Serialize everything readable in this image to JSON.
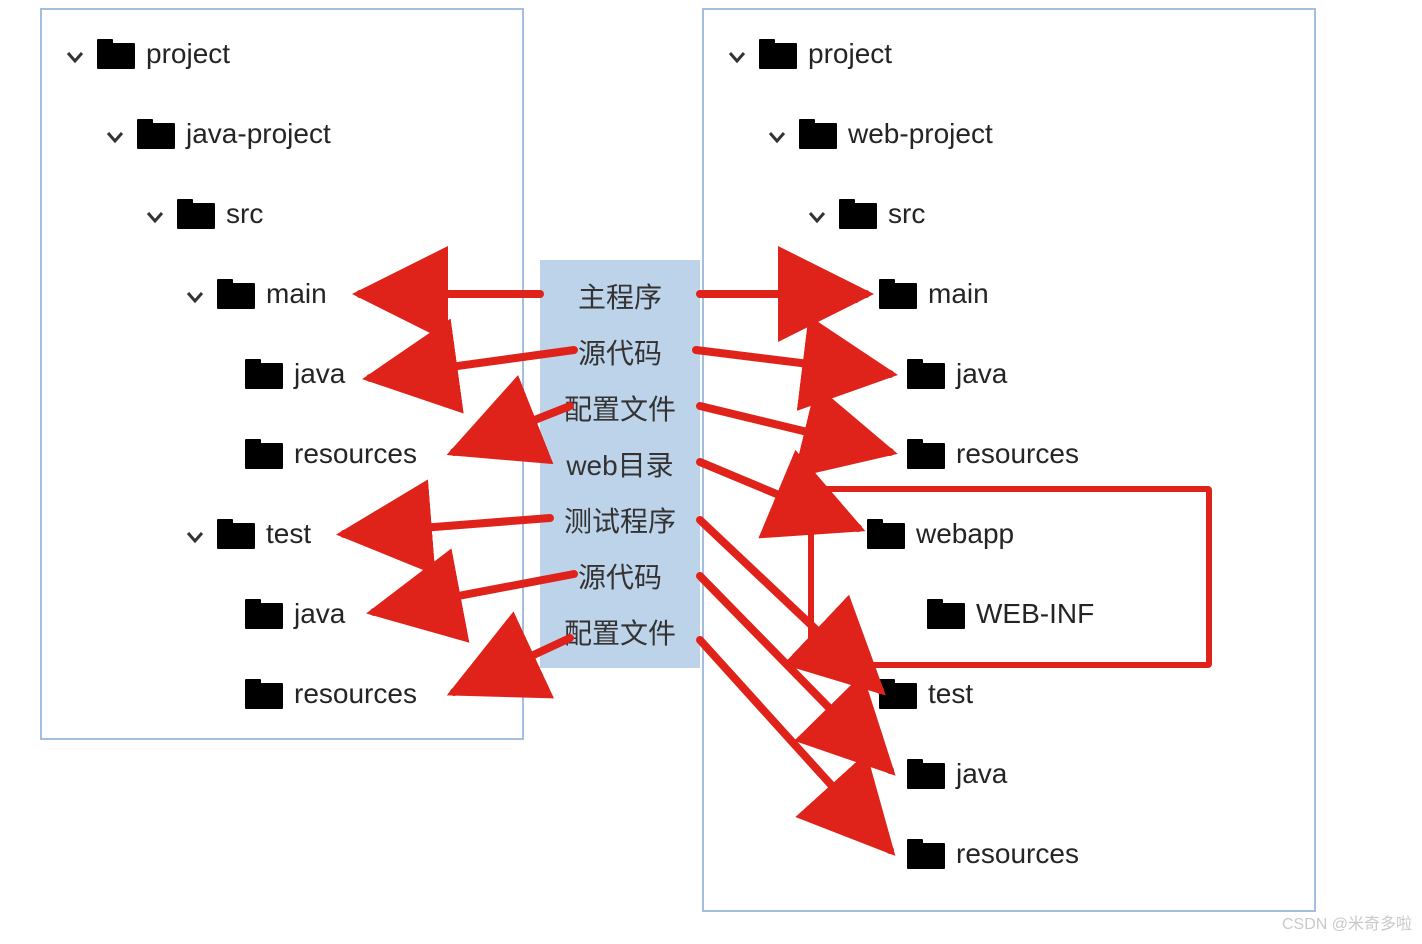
{
  "left_tree": {
    "project": "project",
    "module": "java-project",
    "src": "src",
    "main": "main",
    "main_java": "java",
    "main_resources": "resources",
    "test": "test",
    "test_java": "java",
    "test_resources": "resources"
  },
  "right_tree": {
    "project": "project",
    "module": "web-project",
    "src": "src",
    "main": "main",
    "main_java": "java",
    "main_resources": "resources",
    "webapp": "webapp",
    "webinf": "WEB-INF",
    "test": "test",
    "test_java": "java",
    "test_resources": "resources"
  },
  "callouts": {
    "c1": "主程序",
    "c2": "源代码",
    "c3": "配置文件",
    "c4": "web目录",
    "c5": "测试程序",
    "c6": "源代码",
    "c7": "配置文件"
  },
  "watermark": "CSDN @米奇多啦"
}
